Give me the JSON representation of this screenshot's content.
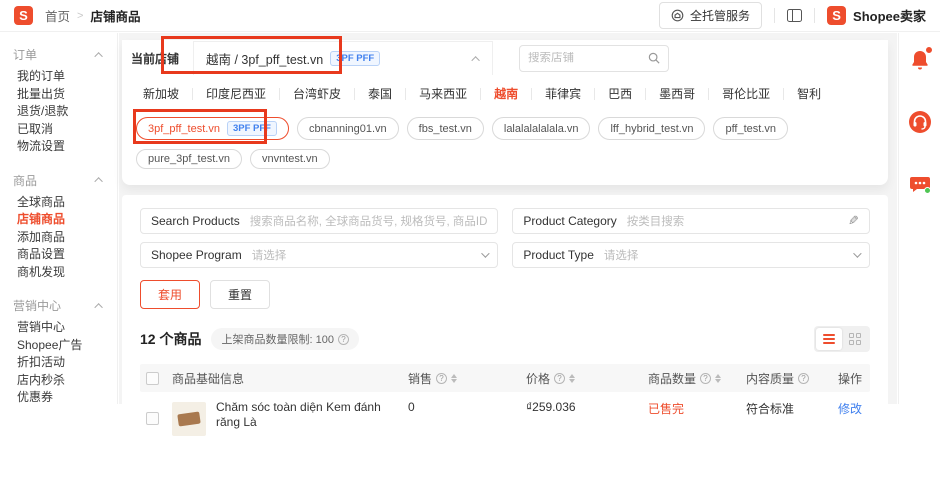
{
  "colors": {
    "accent": "#EE4D2D",
    "link_blue": "#4080EE",
    "badge_blue": "#4080EE",
    "annotation_red": "#E8391D",
    "sold_out_red": "#EE4D2D"
  },
  "header": {
    "logo_letter": "S",
    "breadcrumb": {
      "home": "首页",
      "current": "店铺商品"
    },
    "managed_service": "全托管服务",
    "brand": "Shopee卖家"
  },
  "sidebar": {
    "sections": [
      {
        "title": "订单",
        "items": [
          "我的订单",
          "批量出货",
          "退货/退款",
          "已取消",
          "物流设置"
        ]
      },
      {
        "title": "商品",
        "items": [
          "全球商品",
          "店铺商品",
          "添加商品",
          "商品设置",
          "商机发现"
        ],
        "active_item": "店铺商品"
      },
      {
        "title": "营销中心",
        "items": [
          "营销中心",
          "Shopee广告",
          "折扣活动",
          "店内秒杀",
          "优惠券"
        ]
      }
    ]
  },
  "shop_selector": {
    "label": "当前店铺",
    "current_shop": "越南 / 3pf_pff_test.vn",
    "current_badge": "3PF PFF",
    "search_placeholder": "搜索店铺",
    "regions": [
      "新加坡",
      "印度尼西亚",
      "台湾虾皮",
      "泰国",
      "马来西亚",
      "越南",
      "菲律宾",
      "巴西",
      "墨西哥",
      "哥伦比亚",
      "智利"
    ],
    "active_region": "越南",
    "shops": [
      "3pf_pff_test.vn",
      "cbnanning01.vn",
      "fbs_test.vn",
      "lalalalalalala.vn",
      "lff_hybrid_test.vn",
      "pff_test.vn",
      "pure_3pf_test.vn",
      "vnvntest.vn"
    ],
    "shop_badge": "3PF PFF"
  },
  "filters": {
    "search_products_label": "Search Products",
    "search_products_placeholder": "搜索商品名称, 全球商品货号, 规格货号, 商品ID",
    "product_category_label": "Product Category",
    "product_category_placeholder": "按类目搜索",
    "shopee_program_label": "Shopee Program",
    "shopee_program_placeholder": "请选择",
    "product_type_label": "Product Type",
    "product_type_placeholder": "请选择",
    "apply": "套用",
    "reset": "重置"
  },
  "products": {
    "count": "12 个商品",
    "limit": "上架商品数量限制: 100",
    "columns": [
      "商品基础信息",
      "销售",
      "价格",
      "商品数量",
      "内容质量",
      "操作"
    ],
    "rows": [
      {
        "name": "Chăm sóc toàn diện Kem đánh răng Là",
        "sales": "0",
        "price": "₫259.036",
        "quantity_status": "已售完",
        "content_quality": "符合标准",
        "action": "修改"
      }
    ]
  }
}
